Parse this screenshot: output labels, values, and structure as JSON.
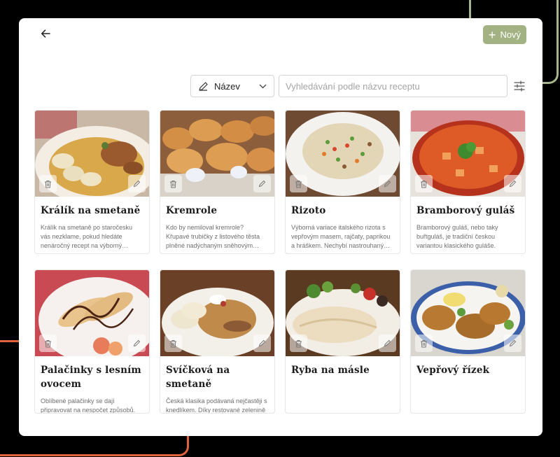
{
  "header": {
    "back_icon": "arrow-left-icon",
    "new_button": {
      "icon": "plus-icon",
      "label": "Nový"
    },
    "accent": "#a3b282"
  },
  "toolbar": {
    "filter": {
      "icon": "pencil-icon",
      "selected": "Název"
    },
    "search": {
      "value": "",
      "placeholder": "Vyhledávání podle názvu receptu"
    },
    "tune_icon": "sliders-icon"
  },
  "recipes": [
    {
      "title": "Králík na smetaně",
      "description": "Králík na smetaně po staročesku vás nezklame, pokud hledáte nenáročný recept na výborný rodinný oběd."
    },
    {
      "title": "Kremrole",
      "description": "Kdo by nemiloval kremrole? Křupavé trubičky z listového těsta plněné nadýchaným sněhovým krémem jsou nebe v puse."
    },
    {
      "title": "Rizoto",
      "description": "Výborná variace italského rizota s vepřovým masem, rajčaty, paprikou a hráškem. Nechybí nastrouhaný sýr."
    },
    {
      "title": "Bramborový guláš",
      "description": "Bramborový guláš, nebo taky buřtguláš, je tradiční českou variantou klasického guláše."
    },
    {
      "title": "Palačinky s lesním ovocem",
      "description": "Oblíbené palačinky se dají připravovat na nespočet způsobů. Vyzkoušejte variantu s vanilkovým krémem."
    },
    {
      "title": "Svíčková na smetaně",
      "description": "Česká klasika podávaná nejčastěji s knedlíkem. Díky restované zelenině a citrónové šťávě."
    },
    {
      "title": "Ryba na másle",
      "description": ""
    },
    {
      "title": "Vepřový řízek",
      "description": ""
    }
  ]
}
